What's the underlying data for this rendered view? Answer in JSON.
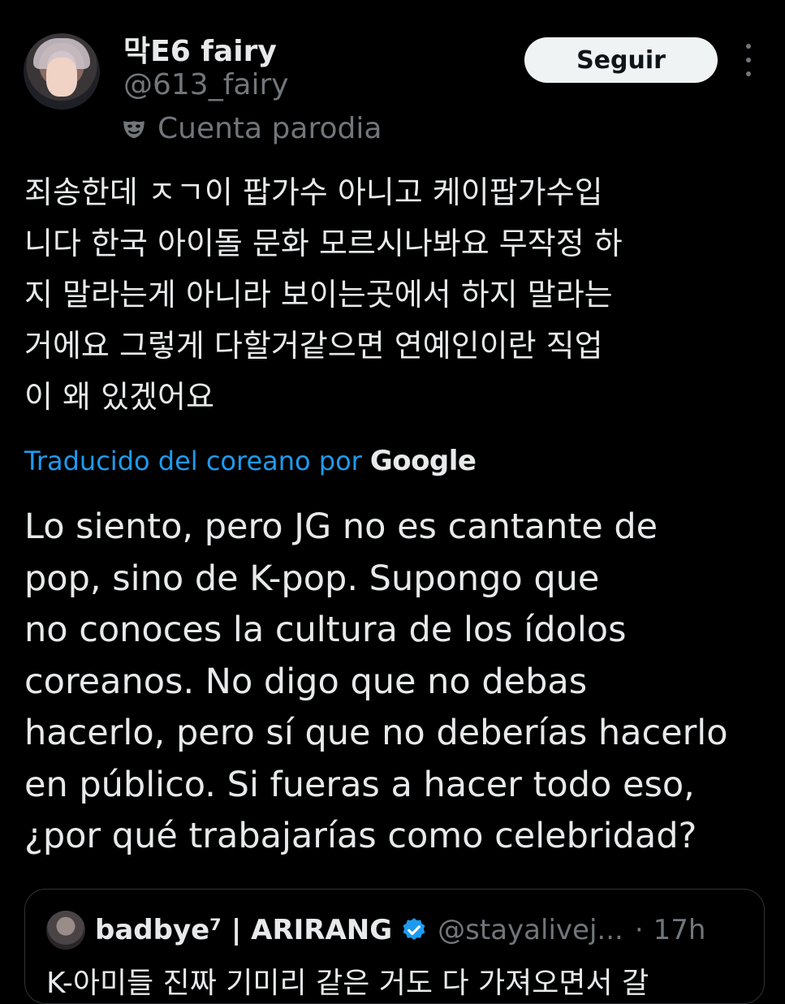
{
  "tweet": {
    "display_name": "막E6 fairy",
    "handle": "@613_fairy",
    "parody_label": "Cuenta parodia",
    "follow_label": "Seguir",
    "text_korean": "죄송한데 ㅈㄱ이 팝가수 아니고 케이팝가수입\n니다 한국 아이돌 문화 모르시나봐요 무작정 하\n지 말라는게 아니라 보이는곳에서 하지 말라는\n거에요 그렇게 다할거같으면 연예인이란 직업\n이 왜 있겠어요",
    "translated_label": "Traducido del coreano por",
    "translator": "Google",
    "text_spanish": "Lo siento, pero JG no es cantante de\npop, sino de K-pop. Supongo que\nno conoces la cultura de los ídolos\ncoreanos. No digo que no debas\nhacerlo, pero sí que no deberías hacerlo\nen público. Si fueras a hacer todo eso,\n¿por qué trabajarías como celebridad?"
  },
  "quoted_tweet": {
    "display_name": "badbye⁷ | ARIRANG",
    "handle": "@stayalivej...",
    "separator": "·",
    "time": "17h",
    "snippet": "K-아미들 진짜 기미리 같은 거도 다 가져오면서 갈"
  },
  "icons": {
    "parody": "mask-icon",
    "verified": "verified-badge-icon",
    "more": "more-options-icon"
  },
  "colors": {
    "background": "#000000",
    "text_primary": "#e7e9ea",
    "text_secondary": "#71767b",
    "link_blue": "#1d9bf0",
    "follow_button_bg": "#eff3f4"
  }
}
